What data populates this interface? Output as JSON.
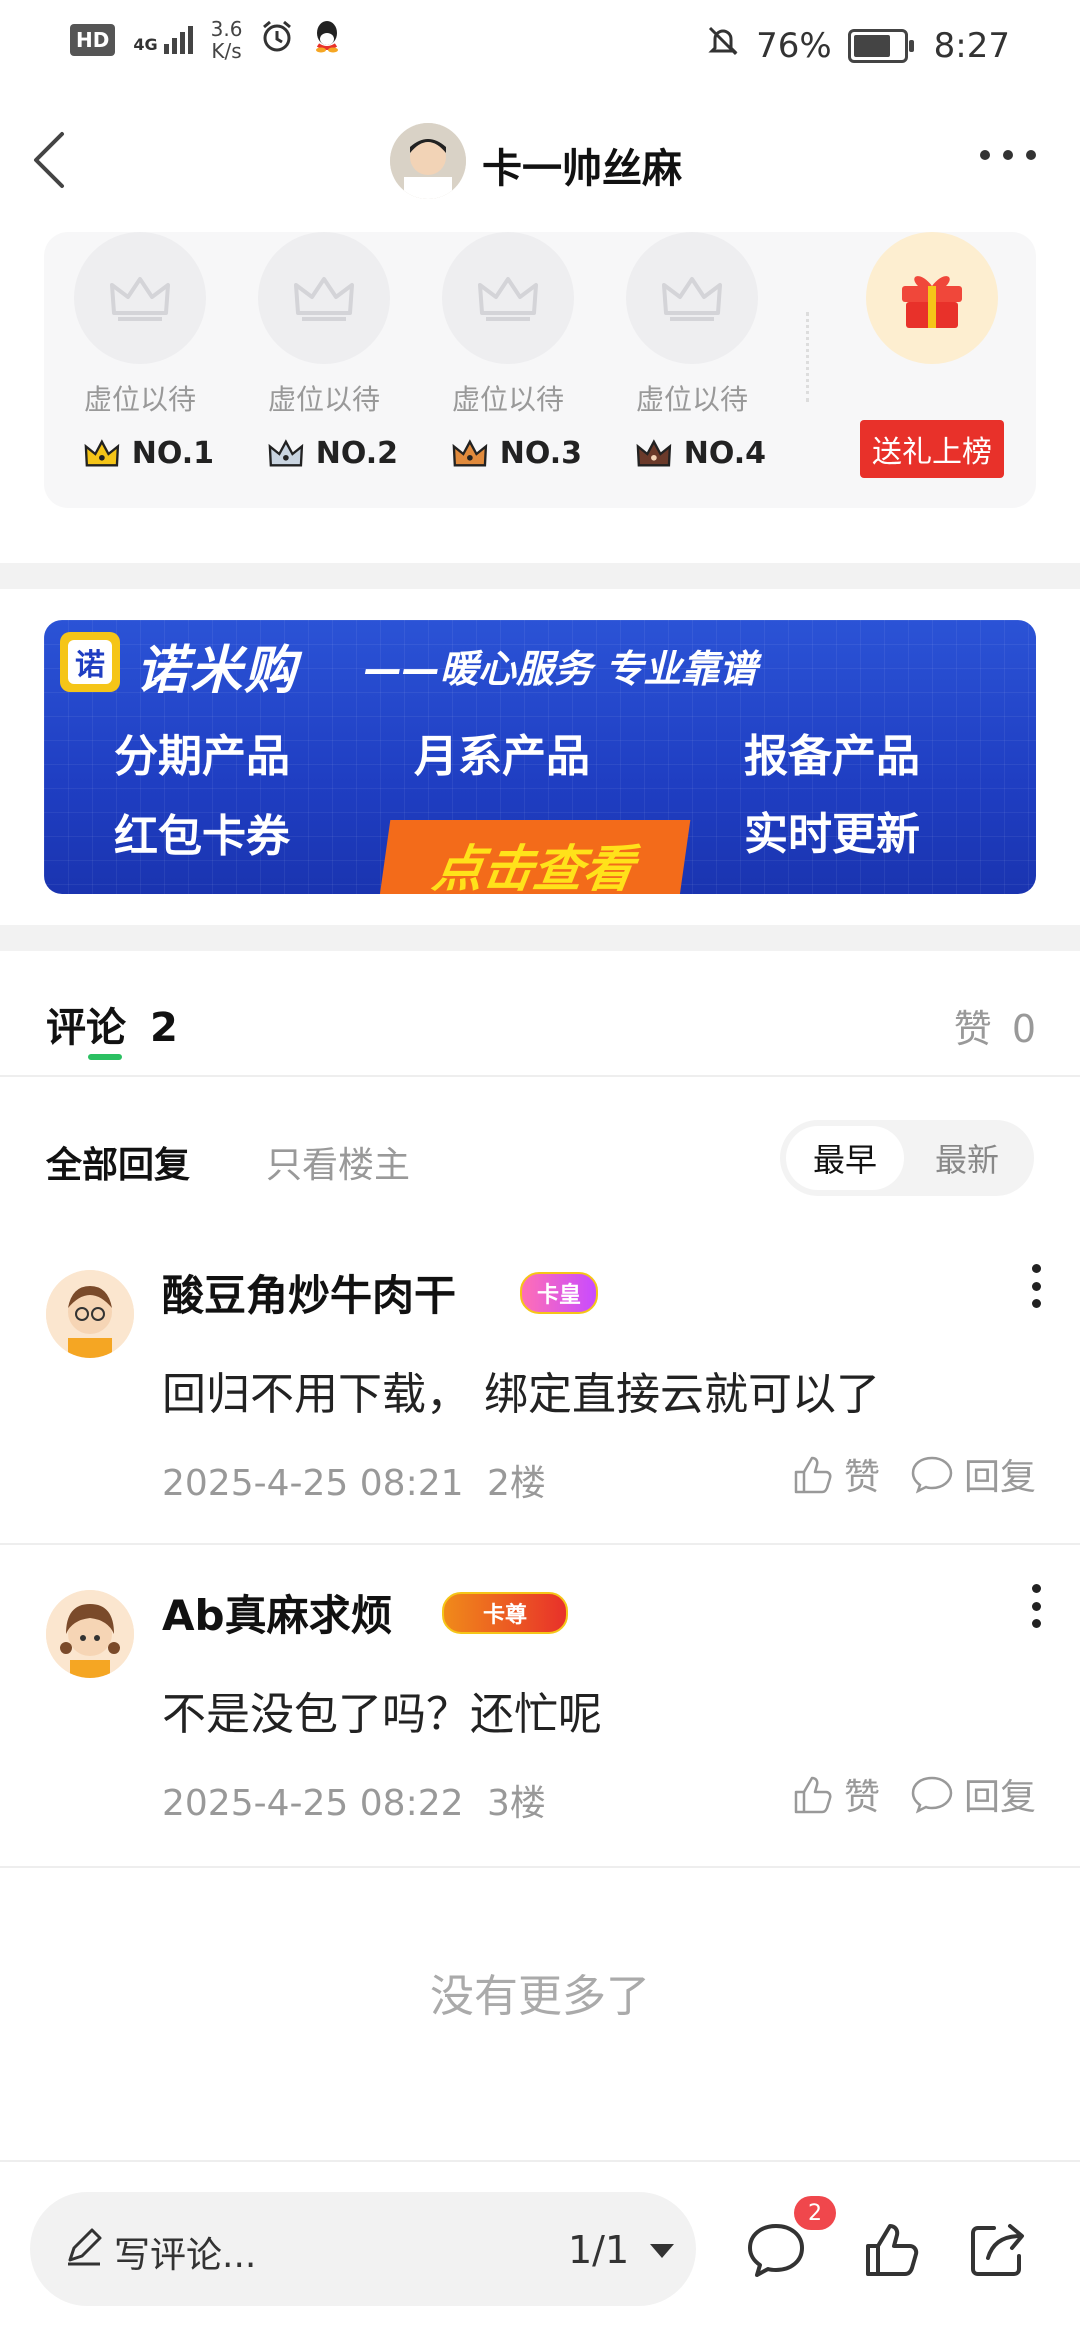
{
  "status_bar": {
    "hd": "HD",
    "network": "4G",
    "speed_value": "3.6",
    "speed_unit": "K/s",
    "battery_percent": "76%",
    "battery_level": 0.76,
    "time": "8:27"
  },
  "header": {
    "title": "卡一帅丝麻"
  },
  "ranking": {
    "slots": [
      {
        "placeholder": "虚位以待",
        "rank": "NO.1"
      },
      {
        "placeholder": "虚位以待",
        "rank": "NO.2"
      },
      {
        "placeholder": "虚位以待",
        "rank": "NO.3"
      },
      {
        "placeholder": "虚位以待",
        "rank": "NO.4"
      }
    ],
    "send_gift_label": "送礼上榜"
  },
  "ad_banner": {
    "logo_char": "诺",
    "brand": "诺米购",
    "slogan": "——暖心服务 专业靠谱",
    "items": [
      "分期产品",
      "月系产品",
      "报备产品",
      "红包卡券",
      "实时更新"
    ],
    "cta": "点击查看"
  },
  "comments_section": {
    "title": "评论",
    "count": "2",
    "likes_label": "赞",
    "likes_count": "0",
    "filters": {
      "all": "全部回复",
      "owner": "只看楼主"
    },
    "sort": {
      "earliest": "最早",
      "latest": "最新"
    },
    "items": [
      {
        "name": "酸豆角炒牛肉干",
        "badge": "卡皇",
        "text": "回归不用下载，  绑定直接云就可以了",
        "date": "2025-4-25 08:21",
        "floor": "2楼",
        "like_label": "赞",
        "reply_label": "回复"
      },
      {
        "name": "Ab真麻求烦",
        "badge": "卡尊",
        "text": "不是没包了吗？还忙呢",
        "date": "2025-4-25 08:22",
        "floor": "3楼",
        "like_label": "赞",
        "reply_label": "回复"
      }
    ],
    "no_more": "没有更多了"
  },
  "bottom_bar": {
    "write_placeholder": "写评论...",
    "page_indicator": "1/1",
    "comment_badge": "2"
  },
  "colors": {
    "accent_green": "#2bc062",
    "red": "#e8312a",
    "banner_blue": "#1f3ec2"
  }
}
